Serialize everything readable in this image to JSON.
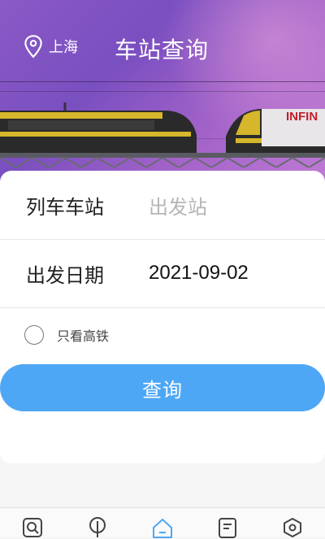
{
  "header": {
    "location": "上海",
    "title": "车站查询",
    "banner_sign": "INFIN"
  },
  "form": {
    "station_label": "列车车站",
    "station_placeholder": "出发站",
    "date_label": "出发日期",
    "date_value": "2021-09-02",
    "high_speed_only_label": "只看高铁",
    "high_speed_only_checked": false,
    "query_button": "查询"
  },
  "colors": {
    "accent": "#4ea7f5",
    "active_tab": "#4ea7f5"
  },
  "bottom_nav": {
    "items": [
      {
        "icon": "search-icon"
      },
      {
        "icon": "map-pin-icon"
      },
      {
        "icon": "home-icon",
        "active": true
      },
      {
        "icon": "list-icon"
      },
      {
        "icon": "settings-icon"
      }
    ]
  }
}
